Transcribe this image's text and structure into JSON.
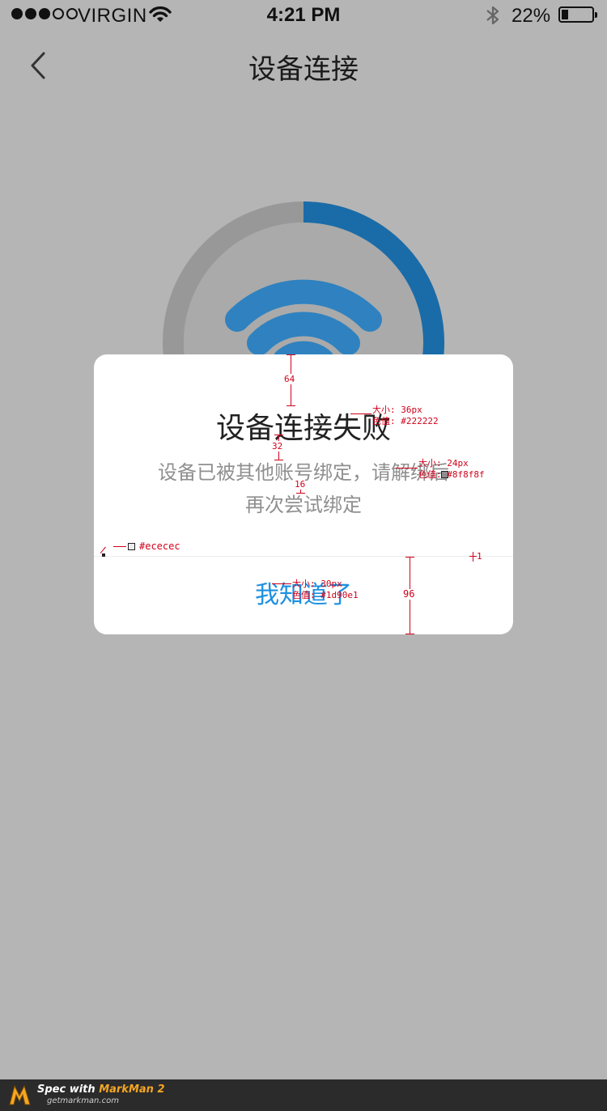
{
  "status_bar": {
    "carrier": "VIRGIN",
    "time": "4:21 PM",
    "battery": "22%",
    "battery_level": 0.22,
    "signal_bars_filled": 3,
    "signal_bars_total": 5,
    "icons": [
      "wifi-icon",
      "bluetooth-icon",
      "battery-icon"
    ]
  },
  "nav": {
    "back_icon": "chevron-left-icon",
    "title": "设备连接"
  },
  "connection": {
    "progress": 0.3,
    "icon": "wifi-icon",
    "colors": {
      "track": "#989898",
      "progress": "#1a6ca8",
      "inner": "#aaaaaa",
      "wifi": "#2f82bf"
    }
  },
  "dialog": {
    "title": "设备连接失败",
    "message_line1": "设备已被其他账号绑定，请解绑后",
    "message_line2": "再次尝试绑定",
    "button_label": "我知道了",
    "colors": {
      "title": "#222222",
      "message": "#8f8f8f",
      "divider": "#ececec",
      "button": "#1d90e1"
    }
  },
  "annotations": {
    "gap_top": "64",
    "gap_title_message": "32",
    "gap_lines": "16",
    "title_spec_size": "大小: 36px",
    "title_spec_color": "色值: #222222",
    "message_spec_size": "大小: 24px",
    "message_spec_color": "色值: #8f8f8f",
    "divider_spec_color": "#ececec",
    "divider_height": "1",
    "button_spec_size": "大小: 30px",
    "button_spec_color": "色值: #1d90e1",
    "button_height": "96"
  },
  "footer": {
    "spec_with": "Spec with ",
    "brand": "MarkMan 2",
    "url": "getmarkman.com"
  }
}
